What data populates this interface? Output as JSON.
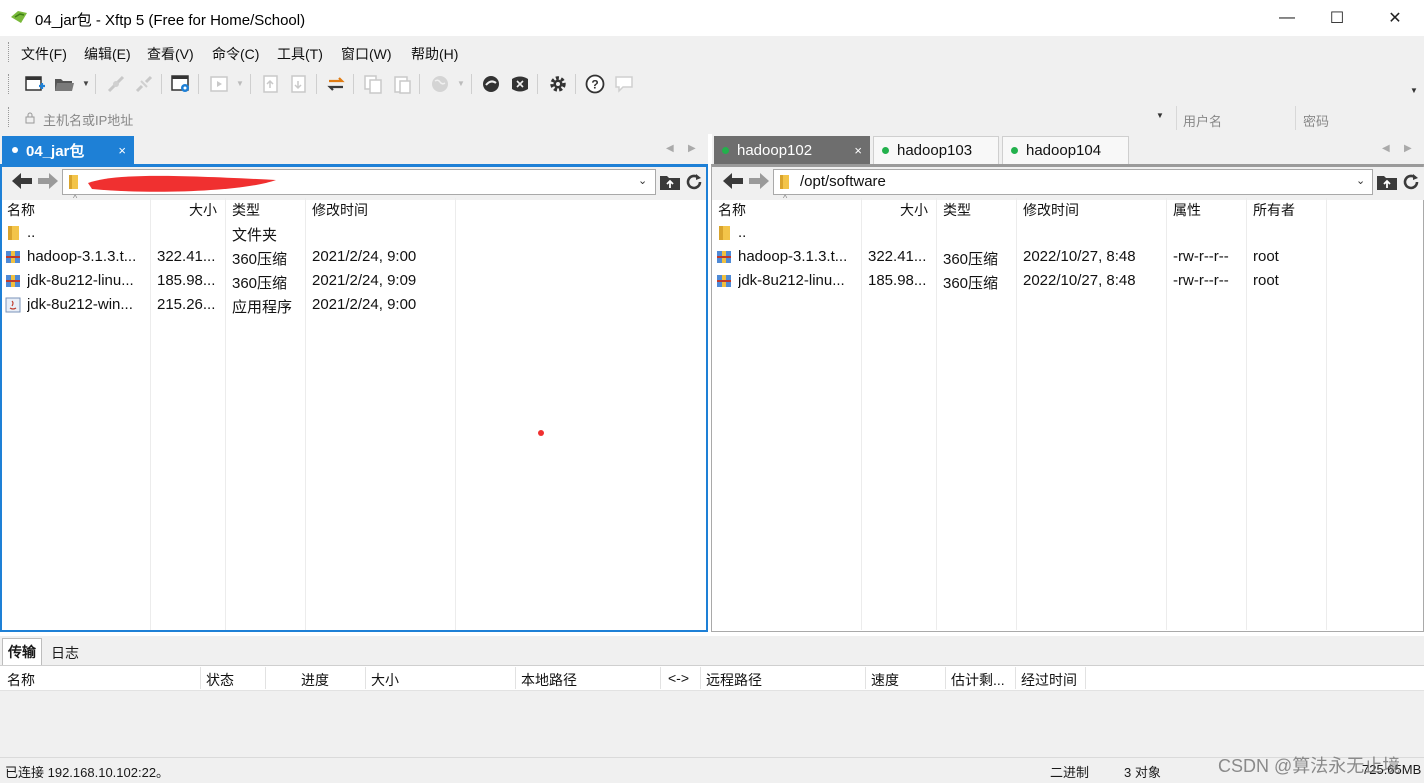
{
  "window": {
    "title": "04_jar包 - Xftp 5 (Free for Home/School)",
    "minimize": "—",
    "maximize": "☐",
    "close": "✕"
  },
  "menu": [
    "文件(F)",
    "编辑(E)",
    "查看(V)",
    "命令(C)",
    "工具(T)",
    "窗口(W)",
    "帮助(H)"
  ],
  "address": {
    "host_placeholder": "主机名或IP地址",
    "user_placeholder": "用户名",
    "password_placeholder": "密码"
  },
  "left_pane": {
    "tabs": [
      {
        "label": "04_jar包",
        "close": "×"
      }
    ],
    "path": "",
    "columns": [
      "名称",
      "大小",
      "类型",
      "修改时间"
    ],
    "rows": [
      {
        "name": "..",
        "size": "",
        "type": "文件夹",
        "modified": "",
        "icon": "folder-icon"
      },
      {
        "name": "hadoop-3.1.3.t...",
        "size": "322.41...",
        "type": "360压缩",
        "modified": "2021/2/24, 9:00",
        "icon": "archive-icon"
      },
      {
        "name": "jdk-8u212-linu...",
        "size": "185.98...",
        "type": "360压缩",
        "modified": "2021/2/24, 9:09",
        "icon": "archive-icon"
      },
      {
        "name": "jdk-8u212-win...",
        "size": "215.26...",
        "type": "应用程序",
        "modified": "2021/2/24, 9:00",
        "icon": "java-exe-icon"
      }
    ]
  },
  "right_pane": {
    "tabs": [
      {
        "label": "hadoop102",
        "close": "×"
      },
      {
        "label": "hadoop103"
      },
      {
        "label": "hadoop104"
      }
    ],
    "path": "/opt/software",
    "columns": [
      "名称",
      "大小",
      "类型",
      "修改时间",
      "属性",
      "所有者"
    ],
    "rows": [
      {
        "name": "..",
        "size": "",
        "type": "",
        "modified": "",
        "attr": "",
        "owner": "",
        "icon": "folder-icon"
      },
      {
        "name": "hadoop-3.1.3.t...",
        "size": "322.41...",
        "type": "360压缩",
        "modified": "2022/10/27, 8:48",
        "attr": "-rw-r--r--",
        "owner": "root",
        "icon": "archive-icon"
      },
      {
        "name": "jdk-8u212-linu...",
        "size": "185.98...",
        "type": "360压缩",
        "modified": "2022/10/27, 8:48",
        "attr": "-rw-r--r--",
        "owner": "root",
        "icon": "archive-icon"
      }
    ]
  },
  "transfer": {
    "tabs": [
      "传输",
      "日志"
    ],
    "columns": [
      "名称",
      "状态",
      "进度",
      "大小",
      "本地路径",
      "<->",
      "远程路径",
      "速度",
      "估计剩...",
      "经过时间"
    ]
  },
  "status": {
    "connected": "已连接 192.168.10.102:22。",
    "mode": "二进制",
    "objects": "3 对象",
    "size": "725.65MB",
    "watermark": "CSDN @算法永无止境"
  },
  "colors": {
    "accent": "#1e80d6",
    "connected_dot": "#22b14c",
    "redaction": "#f03030"
  }
}
